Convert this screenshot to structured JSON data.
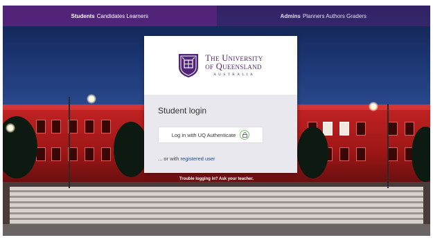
{
  "tabs": {
    "students": {
      "bold": "Students",
      "rest": "Candidates Learners"
    },
    "admins": {
      "bold": "Admins",
      "rest": "Planners Authors Graders"
    }
  },
  "brand": {
    "line1": "The University",
    "line2": "of Queensland",
    "line3": "AUSTRALIA",
    "color": "#51247a"
  },
  "login": {
    "title": "Student login",
    "auth_button": "Log in with UQ Authenticate",
    "auth_icon": "lock-icon",
    "alt_prefix": "... or with",
    "alt_link": "registered user"
  },
  "help": {
    "text": "Trouble logging in? Ask your teacher."
  }
}
